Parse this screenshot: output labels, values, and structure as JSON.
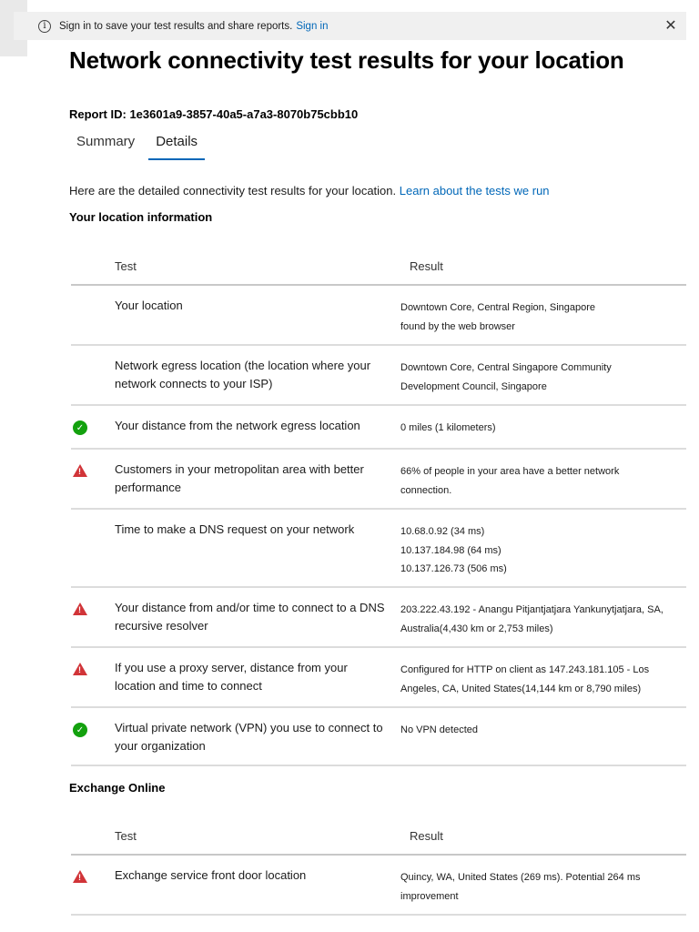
{
  "banner": {
    "message": "Sign in to save your test results and share reports.",
    "signin_label": "Sign in",
    "icon": "info-icon",
    "close_icon": "close-icon"
  },
  "page": {
    "title": "Network connectivity test results for your location",
    "report_id": "Report ID: 1e3601a9-3857-40a5-a7a3-8070b75cbb10"
  },
  "tabs": [
    {
      "label": "Summary",
      "active": false
    },
    {
      "label": "Details",
      "active": true
    }
  ],
  "intro": {
    "text": "Here are the detailed connectivity test results for your location.",
    "link": "Learn about the tests we run"
  },
  "location_section": {
    "title": "Your location information",
    "header": {
      "test": "Test",
      "result": "Result"
    },
    "rows": [
      {
        "status": "none",
        "test": "Your location",
        "result": [
          "Downtown Core, Central Region, Singapore",
          "found by the web browser"
        ]
      },
      {
        "status": "none",
        "test": "Network egress location (the location where your network connects to your ISP)",
        "result": [
          "Downtown Core, Central Singapore Community",
          "Development Council, Singapore"
        ]
      },
      {
        "status": "ok",
        "test": "Your distance from the network egress location",
        "result": [
          "0 miles (1 kilometers)"
        ]
      },
      {
        "status": "warning",
        "test": "Customers in your metropolitan area with better performance",
        "result": [
          "66% of people in your area have a better network",
          "connection."
        ]
      },
      {
        "status": "none",
        "test": "Time to make a DNS request on your network",
        "result": [
          "10.68.0.92 (34 ms)",
          "10.137.184.98 (64 ms)",
          "10.137.126.73 (506 ms)"
        ]
      },
      {
        "status": "warning",
        "test": "Your distance from and/or time to connect to a DNS recursive resolver",
        "result": [
          "203.222.43.192 - Anangu Pitjantjatjara Yankunytjatjara, SA,",
          "Australia(4,430 km or 2,753 miles)"
        ]
      },
      {
        "status": "warning",
        "test": "If you use a proxy server, distance from your location and time to connect",
        "result": [
          "Configured for HTTP on client as 147.243.181.105 - Los",
          "Angeles, CA, United States(14,144 km or 8,790 miles)"
        ]
      },
      {
        "status": "ok",
        "test": "Virtual private network (VPN) you use to connect to your organization",
        "result": [
          "No VPN detected"
        ]
      }
    ]
  },
  "exchange_section": {
    "title": "Exchange Online",
    "header": {
      "test": "Test",
      "result": "Result"
    },
    "rows": [
      {
        "status": "warning",
        "test": "Exchange service front door location",
        "result": [
          "Quincy, WA, United States (269 ms). Potential 264 ms",
          "improvement"
        ]
      }
    ]
  },
  "colors": {
    "link": "#0067b8",
    "ok": "#13a10e",
    "warning": "#d13438"
  }
}
